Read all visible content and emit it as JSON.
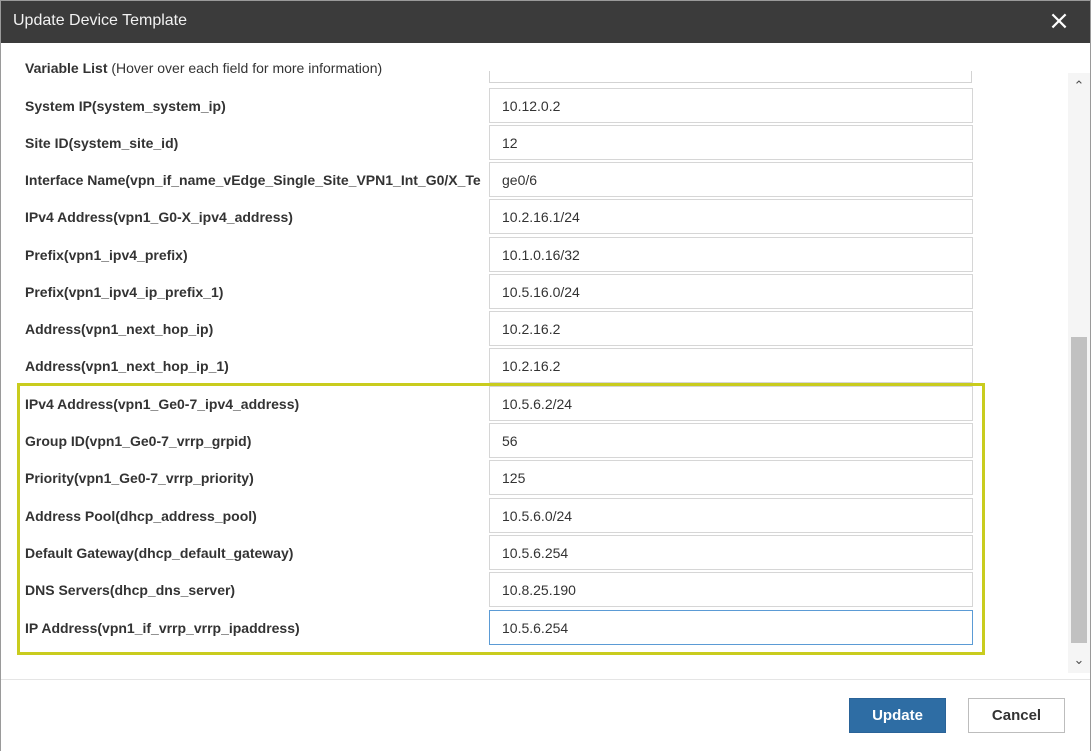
{
  "dialog": {
    "title": "Update Device Template",
    "close_icon": "×"
  },
  "variable_list": {
    "title": "Variable List",
    "hint": "(Hover over each field for more information)"
  },
  "fields": [
    {
      "label": "System IP(system_system_ip)",
      "value": "10.12.0.2"
    },
    {
      "label": "Site ID(system_site_id)",
      "value": "12"
    },
    {
      "label": "Interface Name(vpn_if_name_vEdge_Single_Site_VPN1_Int_G0/X_Te",
      "value": "ge0/6"
    },
    {
      "label": "IPv4 Address(vpn1_G0-X_ipv4_address)",
      "value": "10.2.16.1/24"
    },
    {
      "label": "Prefix(vpn1_ipv4_prefix)",
      "value": "10.1.0.16/32"
    },
    {
      "label": "Prefix(vpn1_ipv4_ip_prefix_1)",
      "value": "10.5.16.0/24"
    },
    {
      "label": "Address(vpn1_next_hop_ip)",
      "value": "10.2.16.2"
    },
    {
      "label": "Address(vpn1_next_hop_ip_1)",
      "value": "10.2.16.2"
    },
    {
      "label": "IPv4 Address(vpn1_Ge0-7_ipv4_address)",
      "value": "10.5.6.2/24"
    },
    {
      "label": "Group ID(vpn1_Ge0-7_vrrp_grpid)",
      "value": "56"
    },
    {
      "label": "Priority(vpn1_Ge0-7_vrrp_priority)",
      "value": "125"
    },
    {
      "label": "Address Pool(dhcp_address_pool)",
      "value": "10.5.6.0/24"
    },
    {
      "label": "Default Gateway(dhcp_default_gateway)",
      "value": "10.5.6.254"
    },
    {
      "label": "DNS Servers(dhcp_dns_server)",
      "value": "10.8.25.190"
    },
    {
      "label": "IP Address(vpn1_if_vrrp_vrrp_ipaddress)",
      "value": "10.5.6.254"
    }
  ],
  "scrollbar": {
    "up_arrow": "⌃",
    "down_arrow": "⌄"
  },
  "footer": {
    "update_label": "Update",
    "cancel_label": "Cancel"
  },
  "colors": {
    "titlebar": "#3b3b3b",
    "primary_button": "#2e6da4",
    "highlight_border": "#c9cc1e",
    "focus_border": "#5b9bd5"
  }
}
